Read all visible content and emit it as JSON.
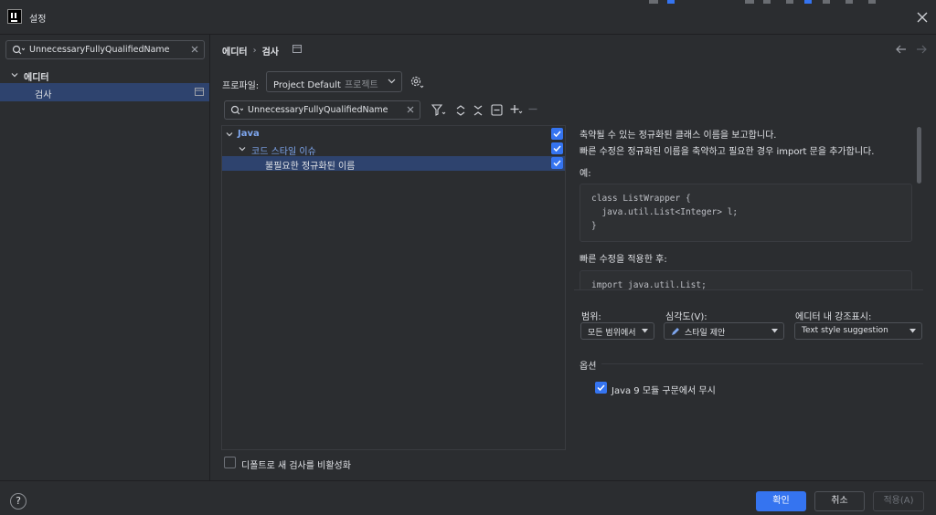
{
  "window": {
    "title": "설정",
    "close_icon": "close-icon"
  },
  "sidebar": {
    "search_value": "UnnecessaryFullyQualifiedName",
    "tree": [
      {
        "label": "에디터",
        "expanded": true
      },
      {
        "label": "검사",
        "selected": true
      }
    ]
  },
  "header": {
    "breadcrumb": [
      "에디터",
      "검사"
    ],
    "separator": "›"
  },
  "profile": {
    "label": "프로파일:",
    "value": "Project Default",
    "scope": "프로젝트"
  },
  "inspection_search": {
    "value": "UnnecessaryFullyQualifiedName"
  },
  "inspection_tree": [
    {
      "label": "Java",
      "checked": true,
      "level": 0
    },
    {
      "label": "코드 스타일 이슈",
      "checked": true,
      "level": 1
    },
    {
      "label": "불필요한 정규화된 이름",
      "checked": true,
      "level": 2,
      "selected": true
    }
  ],
  "description": {
    "line1": "축약될 수 있는 정규화된 클래스 이름을 보고합니다.",
    "line2": "빠른 수정은 정규화된 이름을 축약하고 필요한 경우 import 문을 추가합니다.",
    "example_label": "예:",
    "code_before": [
      "class ListWrapper {",
      "  java.util.List<Integer> l;",
      "}"
    ],
    "after_label": "빠른 수정을 적용한 후:",
    "code_after": [
      "import java.util.List;"
    ]
  },
  "settings": {
    "scope_label": "범위:",
    "scope_value": "모든 범위에서",
    "severity_label": "심각도(V):",
    "severity_value": "스타일 제안",
    "highlight_label": "에디터 내 강조표시:",
    "highlight_value": "Text style suggestion"
  },
  "options": {
    "title": "옵션",
    "java9_label": "Java 9 모듈 구문에서 무시",
    "java9_checked": true
  },
  "disable_new_label": "디폴트로 새 검사를 비활성화",
  "disable_new_checked": false,
  "footer": {
    "help": "?",
    "ok": "확인",
    "cancel": "취소",
    "apply": "적용(A)"
  },
  "colors": {
    "background": "#2b2d30",
    "selection": "#2e436e",
    "accent": "#3574f0",
    "tree_link": "#7ea6ee"
  }
}
